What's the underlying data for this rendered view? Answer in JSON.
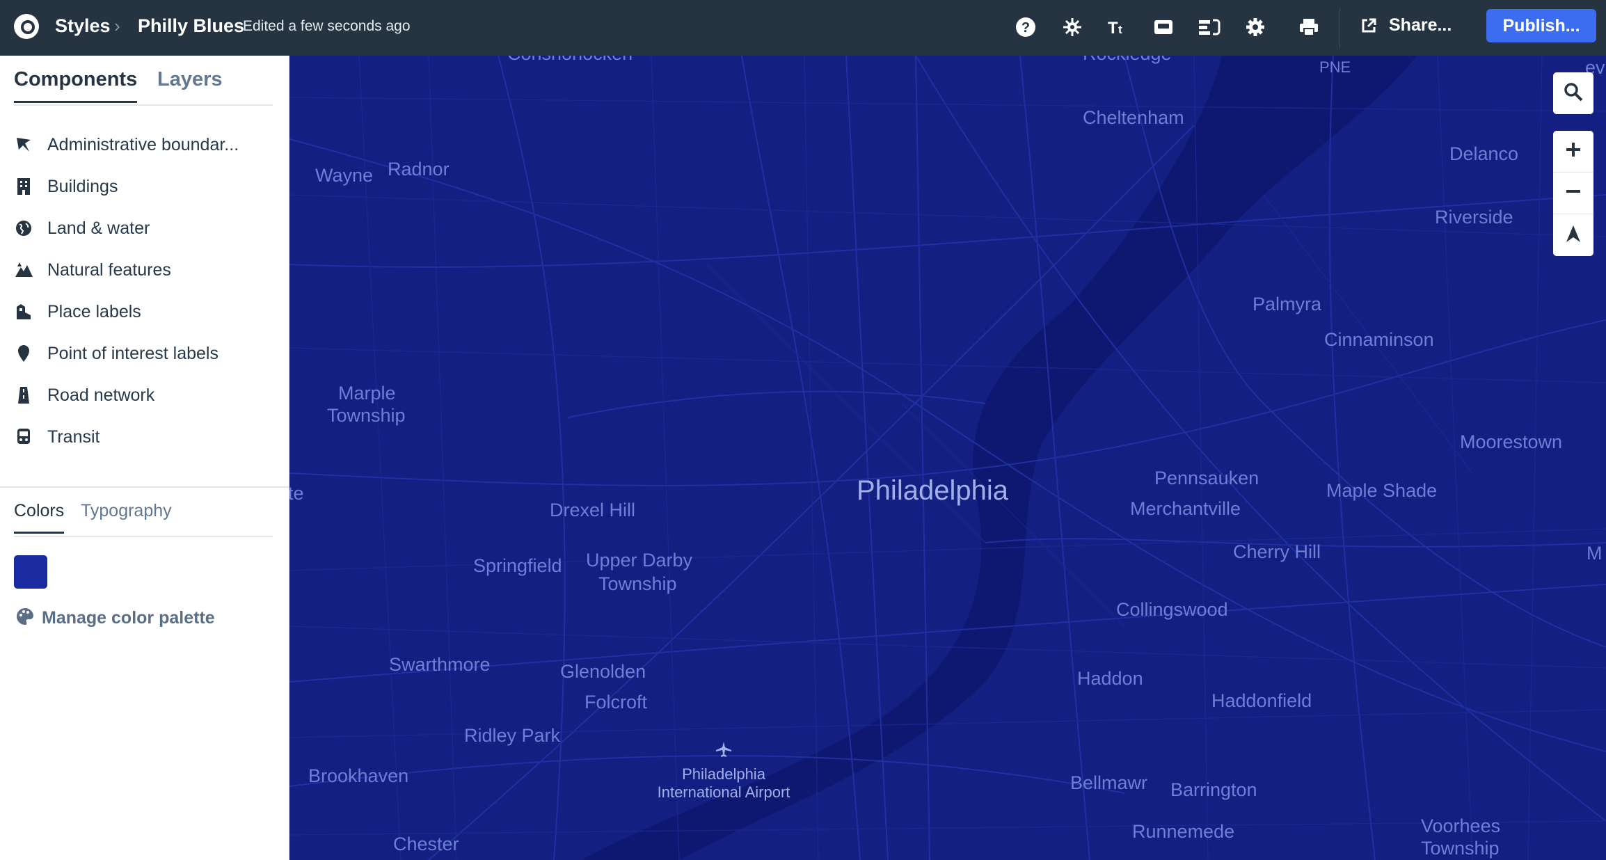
{
  "header": {
    "breadcrumb_root": "Styles",
    "breadcrumb_separator": "›",
    "style_title": "Philly Blues",
    "status": "Edited a few seconds ago",
    "share_label": "Share...",
    "publish_label": "Publish...",
    "toolbar_icons": [
      "help-icon",
      "settings-sparkle-icon",
      "typography-icon",
      "preview-icon",
      "layout-icon",
      "gear-icon",
      "print-icon"
    ]
  },
  "sidebar": {
    "tabs": [
      {
        "label": "Components",
        "active": true
      },
      {
        "label": "Layers",
        "active": false
      }
    ],
    "components": [
      {
        "label": "Administrative boundar...",
        "icon": "flag-icon"
      },
      {
        "label": "Buildings",
        "icon": "building-icon"
      },
      {
        "label": "Land & water",
        "icon": "globe-icon"
      },
      {
        "label": "Natural features",
        "icon": "mountain-icon"
      },
      {
        "label": "Place labels",
        "icon": "place-icon"
      },
      {
        "label": "Point of interest labels",
        "icon": "marker-icon"
      },
      {
        "label": "Road network",
        "icon": "road-icon"
      },
      {
        "label": "Transit",
        "icon": "transit-icon"
      }
    ],
    "style_tabs": [
      {
        "label": "Colors",
        "active": true
      },
      {
        "label": "Typography",
        "active": false
      }
    ],
    "swatch_color": "#1a2aa1",
    "manage_palette_label": "Manage color palette"
  },
  "map": {
    "background": "#141f82",
    "center_label": "Philadelphia",
    "airport_label_line1": "Philadelphia",
    "airport_label_line2": "International Airport",
    "places": [
      "Conshohocken",
      "PNE",
      "Cheltenham",
      "Delanco",
      "Wayne",
      "Radnor",
      "Riverside",
      "Palmyra",
      "Cinnaminson",
      "Marple",
      "Township",
      "Moorestown",
      "Pennsauken",
      "Maple Shade",
      "Merchantville",
      "Drexel Hill",
      "Springfield",
      "Upper Darby",
      "Township",
      "Cherry Hill",
      "Collingswood",
      "Swarthmore",
      "Glenolden",
      "Folcroft",
      "Haddon",
      "Haddonfield",
      "Ridley Park",
      "Brookhaven",
      "Bellmawr",
      "Barrington",
      "Runnemede",
      "Chester",
      "Voorhees",
      "Township",
      "te",
      "M",
      "Rockledge",
      "ev"
    ],
    "controls": [
      "search-icon",
      "zoom-in-icon",
      "zoom-out-icon",
      "compass-icon"
    ]
  }
}
